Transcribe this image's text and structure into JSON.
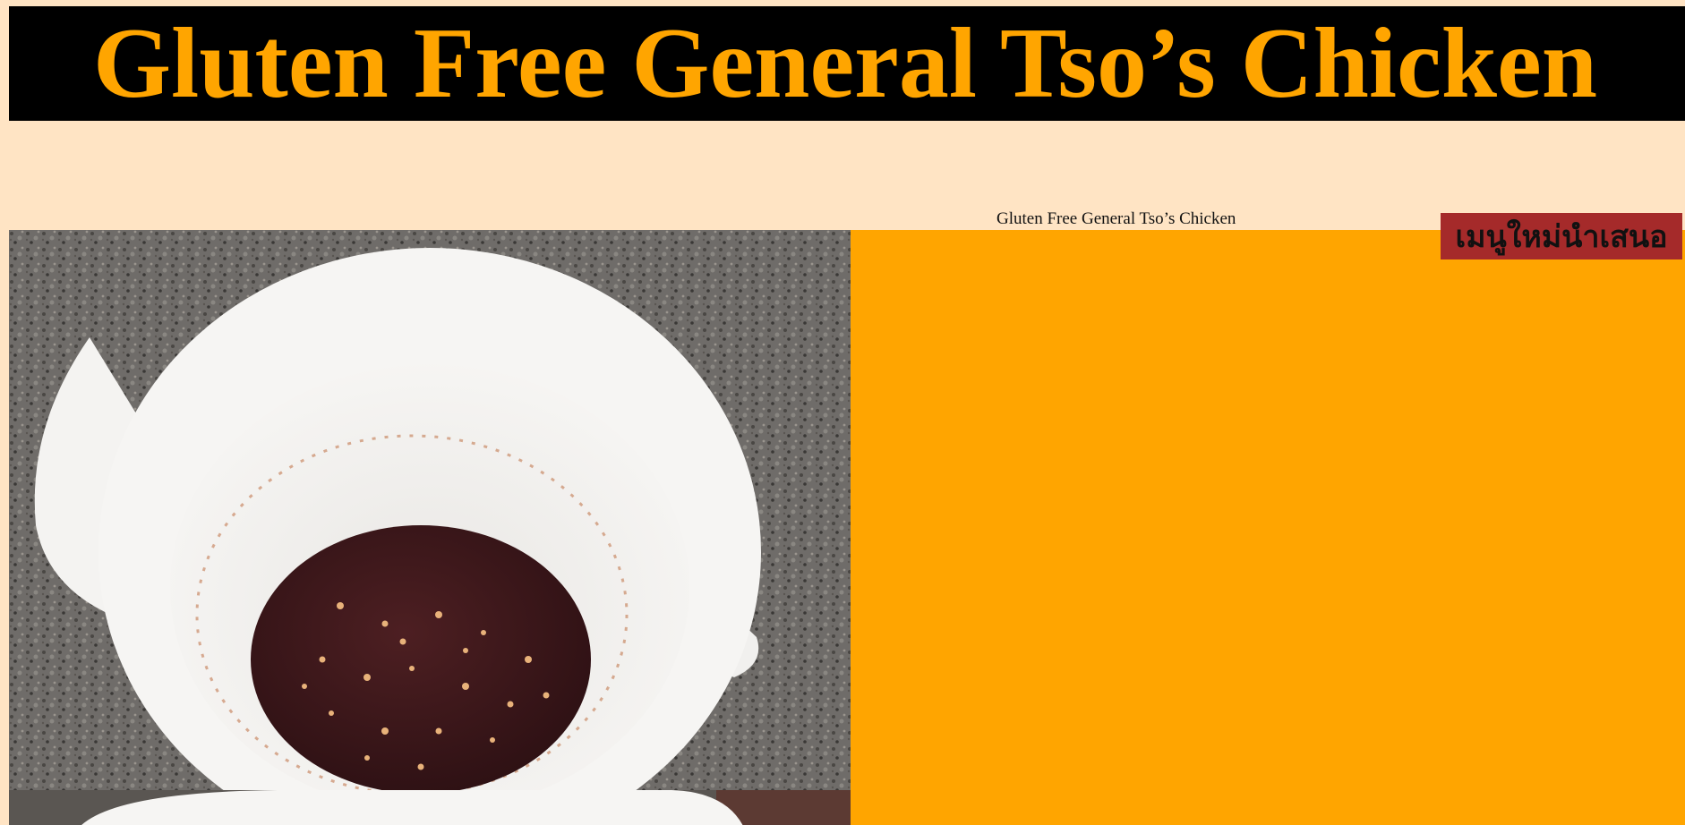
{
  "page": {
    "title": "Gluten Free General Tso’s Chicken",
    "caption": "Gluten Free General Tso’s Chicken",
    "menu_button_label": "เมนูใหม่นำเสนอ"
  },
  "gallery": {
    "images": [
      {
        "name": "sauce-bowl-photo",
        "subject": "white bowl of dark sauce with chili flakes on granite counter"
      },
      {
        "name": "second-bowl-photo",
        "subject": "partially visible white bowl"
      }
    ]
  },
  "colors": {
    "page_background": "#ffe4c4",
    "header_background": "#000000",
    "header_text": "#ffa500",
    "side_panel": "#ffa500",
    "menu_button": "#a52a2a"
  }
}
